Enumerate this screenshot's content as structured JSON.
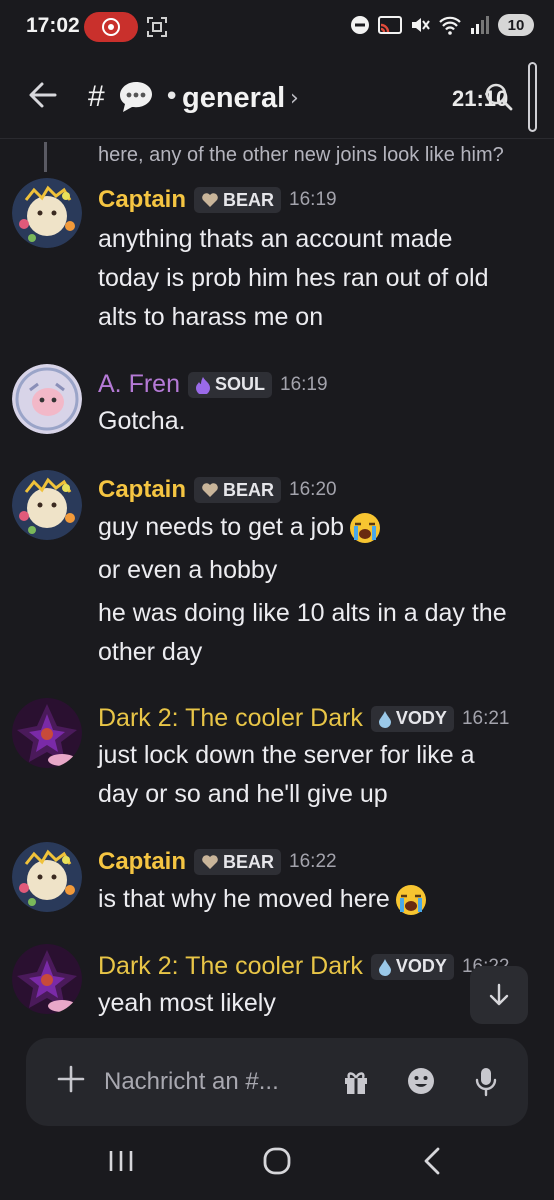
{
  "status_bar": {
    "time": "17:02",
    "battery": "10",
    "icons": [
      "screen-record-icon",
      "screenshot-icon",
      "dnd-icon",
      "cast-icon",
      "mute-icon",
      "wifi-icon",
      "signal-icon",
      "battery-icon"
    ]
  },
  "header": {
    "hash": "#",
    "separator": "•",
    "channel": "general",
    "chevron": "›",
    "time": "21:10",
    "icons": [
      "back-arrow-icon",
      "speech-bubble-icon",
      "search-icon"
    ]
  },
  "reply_preview": "here, any of the other new joins look like him?",
  "messages": [
    {
      "author": "Captain",
      "tag": "BEAR",
      "time": "16:19",
      "lines": [
        "anything thats an account made",
        "today is prob him hes ran out of old",
        "alts to harass me on"
      ]
    },
    {
      "author": "A. Fren",
      "tag": "SOUL",
      "time": "16:19",
      "lines": [
        "Gotcha."
      ]
    },
    {
      "author": "Captain",
      "tag": "BEAR",
      "time": "16:20",
      "lines": [
        "guy needs to get a job",
        "or even a hobby",
        "he was doing like 10 alts in a day the",
        "other day"
      ]
    },
    {
      "author": "Dark 2: The cooler Dark",
      "tag": "VODY",
      "time": "16:21",
      "lines": [
        "just lock down the server for like a",
        "day or so and he'll give up"
      ]
    },
    {
      "author": "Captain",
      "tag": "BEAR",
      "time": "16:22",
      "lines": [
        "is that why he moved here"
      ]
    },
    {
      "author": "Dark 2: The cooler Dark",
      "tag": "VODY",
      "time": "16:22",
      "lines": [
        "yeah most likely"
      ]
    }
  ],
  "composer": {
    "placeholder": "Nachricht an #...",
    "icons": [
      "plus-icon",
      "gift-icon",
      "emoji-icon",
      "microphone-icon"
    ]
  },
  "nav": {
    "icons": [
      "recents-icon",
      "home-icon",
      "back-icon"
    ]
  },
  "colors": {
    "background": "#1a1a1e",
    "captain": "#f5c542",
    "fren": "#b57ad6",
    "dark": "#e8c547",
    "tag_bg": "#2e2f35",
    "record": "#c9302c"
  }
}
